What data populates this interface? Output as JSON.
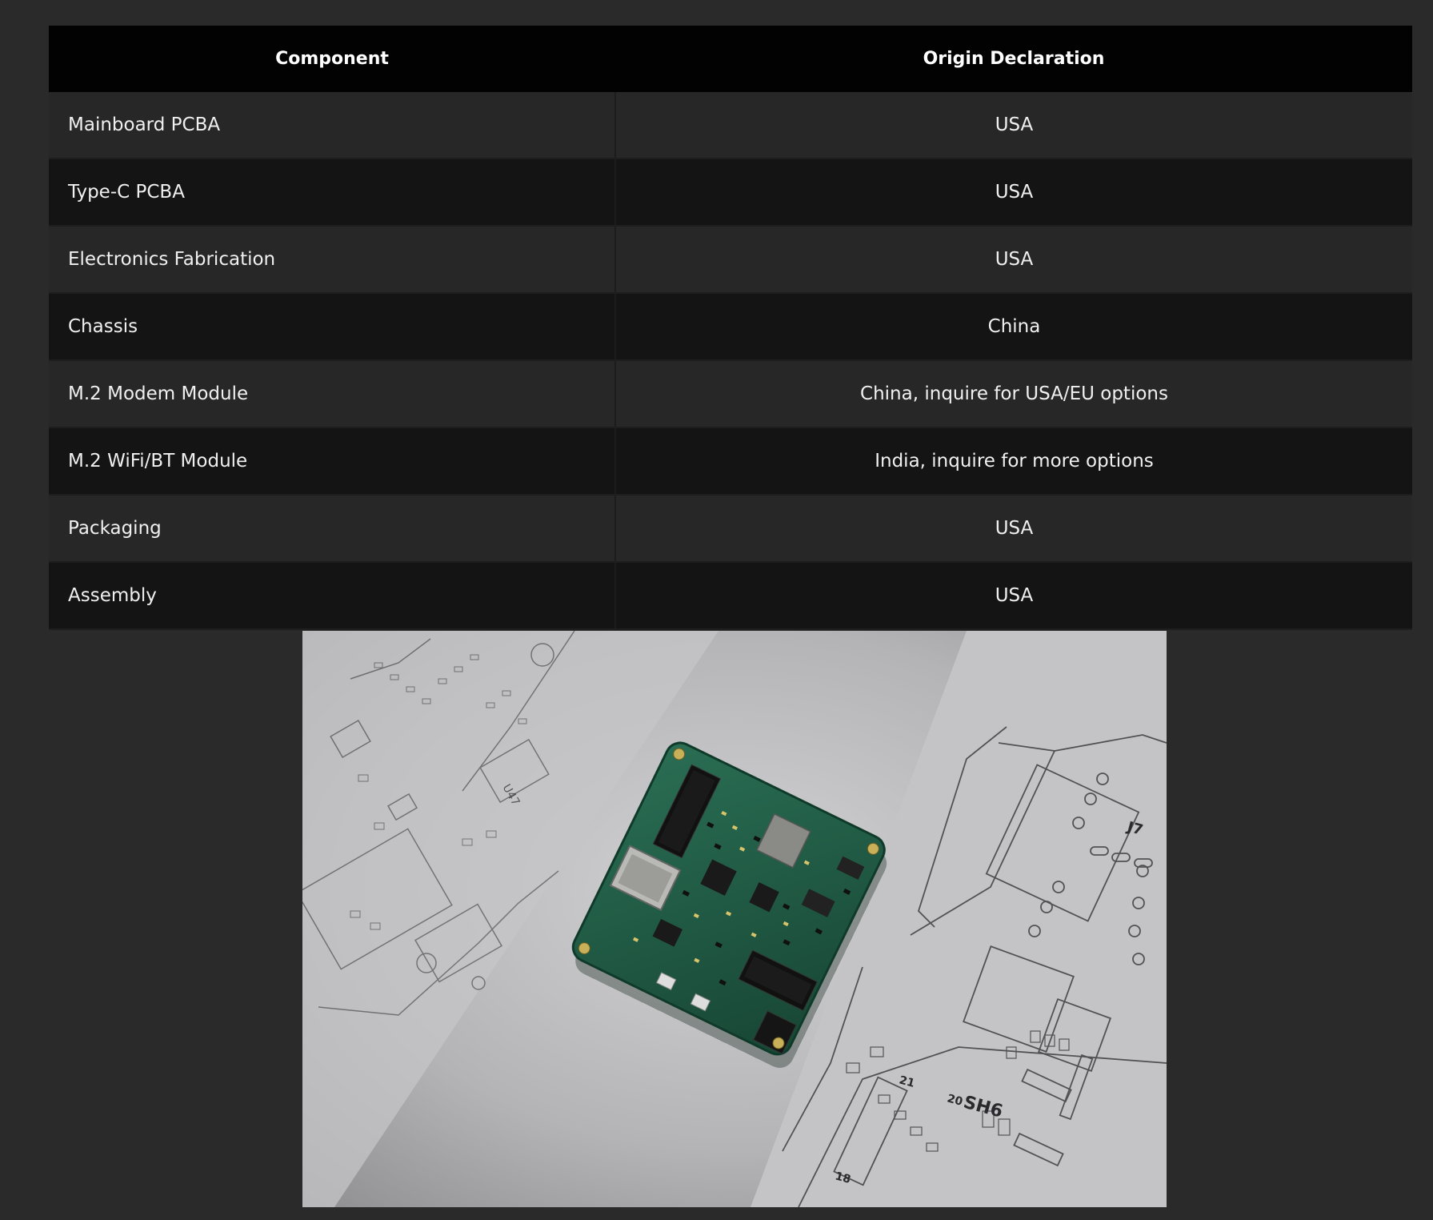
{
  "table": {
    "headers": {
      "component": "Component",
      "origin": "Origin Declaration"
    },
    "rows": [
      {
        "component": "Mainboard PCBA",
        "origin": "USA"
      },
      {
        "component": "Type-C PCBA",
        "origin": "USA"
      },
      {
        "component": "Electronics Fabrication",
        "origin": "USA"
      },
      {
        "component": "Chassis",
        "origin": "China"
      },
      {
        "component": "M.2 Modem Module",
        "origin": "China, inquire for USA/EU options"
      },
      {
        "component": "M.2 WiFi/BT Module",
        "origin": "India, inquire for more options"
      },
      {
        "component": "Packaging",
        "origin": "USA"
      },
      {
        "component": "Assembly",
        "origin": "USA"
      }
    ]
  },
  "photo": {
    "labels": {
      "j7": "J7",
      "sh6": "SH6",
      "u47": "U47",
      "n21": "21",
      "n20": "20",
      "n18": "18"
    }
  },
  "colors": {
    "page_background": "#2a2a2a",
    "header_background": "#020202",
    "row_odd": "#272727",
    "row_even": "#141414",
    "pcb_green": "#1f5a45"
  }
}
